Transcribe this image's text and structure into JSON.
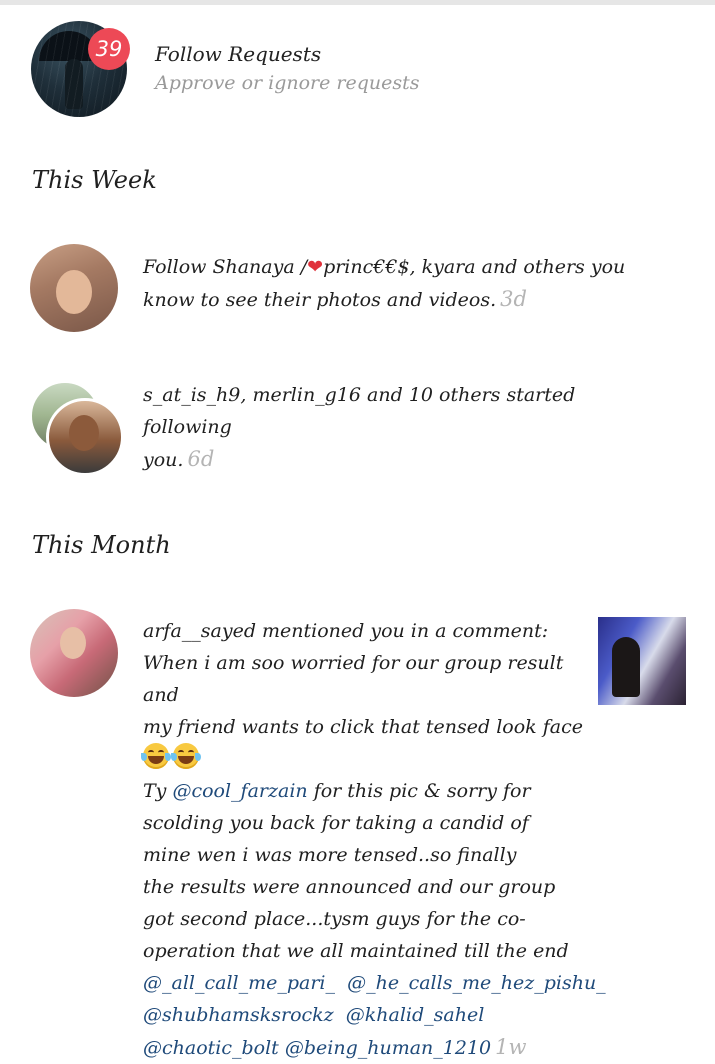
{
  "follow_requests": {
    "count": "39",
    "title": "Follow Requests",
    "subtitle": "Approve or ignore requests"
  },
  "sections": {
    "this_week": "This Week",
    "this_month": "This Month"
  },
  "notifications": {
    "suggest": {
      "prefix": "Follow Shanaya /",
      "heart": "❤",
      "name_rest": "princ€€$",
      "rest_line1": ", kyara and others you",
      "line2": "know to see their photos and videos.",
      "time": "3d"
    },
    "followers": {
      "line1": "s_at_is_h9, merlin_g16 and 10 others started following",
      "line2": "you.",
      "time": "6d"
    },
    "mention": {
      "line1": "arfa__sayed mentioned you in a comment:",
      "line2": "When i am soo worried for our group result and",
      "line3": "my friend wants to click that tensed look face",
      "line5_prefix": "Ty ",
      "line5_mention": "@cool_farzain",
      "line5_suffix": " for this pic &  sorry for",
      "line6": "scolding you back for taking a candid of",
      "line7": "mine wen i was more tensed..so finally",
      "line8": "the results were announced and our group",
      "line9": "got second place...tysm guys for the co-",
      "line10": "operation that we all  maintained till the end",
      "mentions_row1": [
        "@_all_call_me_pari_",
        "@_he_calls_me_hez_pishu_"
      ],
      "mentions_row2": [
        "@shubhamsksrockz",
        "@khalid_sahel"
      ],
      "mentions_row3": [
        "@chaotic_bolt",
        "@being_human_1210"
      ],
      "time": "1w"
    }
  },
  "icons": {
    "emoji": "tears-of-joy-emoji"
  },
  "colors": {
    "badge": "#ed4956",
    "mention": "#1f4a7a",
    "secondary_text": "#9a9a9a",
    "timestamp": "#b4b4b4"
  }
}
